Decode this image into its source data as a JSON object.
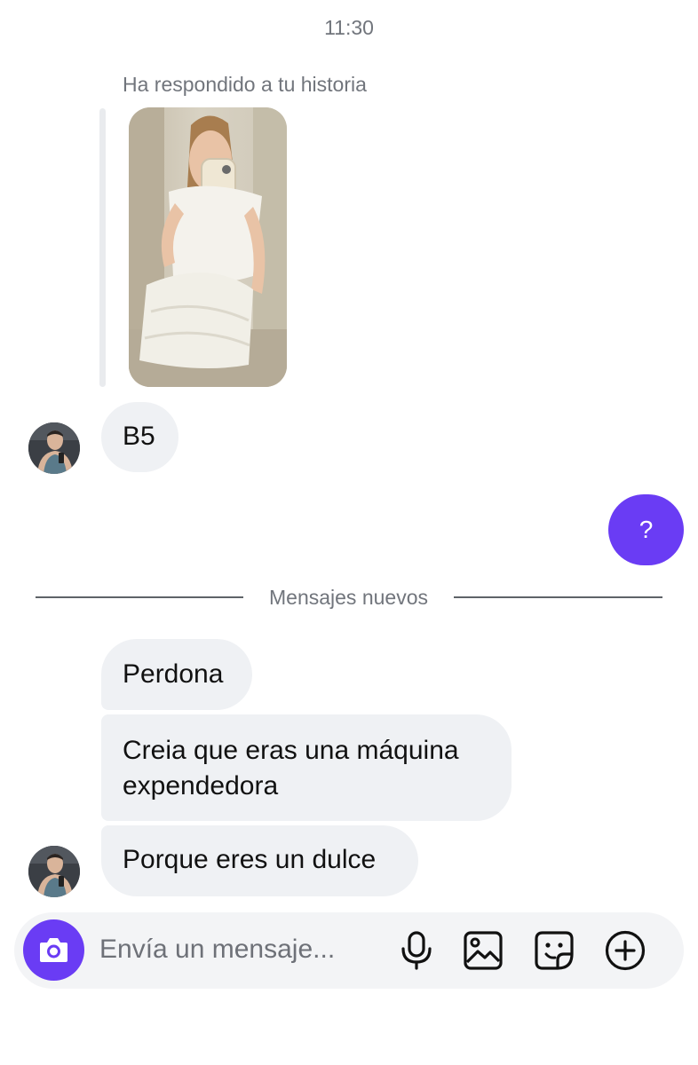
{
  "header": {
    "time": "11:30"
  },
  "story_reply": {
    "caption": "Ha respondido a tu historia"
  },
  "messages": {
    "b5": "B5",
    "sent_question": "?",
    "perdona": "Perdona",
    "creia_line1": "Creia que eras una máquina",
    "creia_line2": "expendedora",
    "dulce": "Porque eres un dulce"
  },
  "divider": {
    "label": "Mensajes nuevos"
  },
  "composer": {
    "placeholder": "Envía un mensaje...",
    "icons": [
      "camera-icon",
      "microphone-icon",
      "gallery-icon",
      "sticker-icon",
      "plus-circle-icon"
    ]
  },
  "colors": {
    "accent": "#6a3cf4",
    "received_bubble": "#eff1f4",
    "muted_text": "#71757c"
  }
}
